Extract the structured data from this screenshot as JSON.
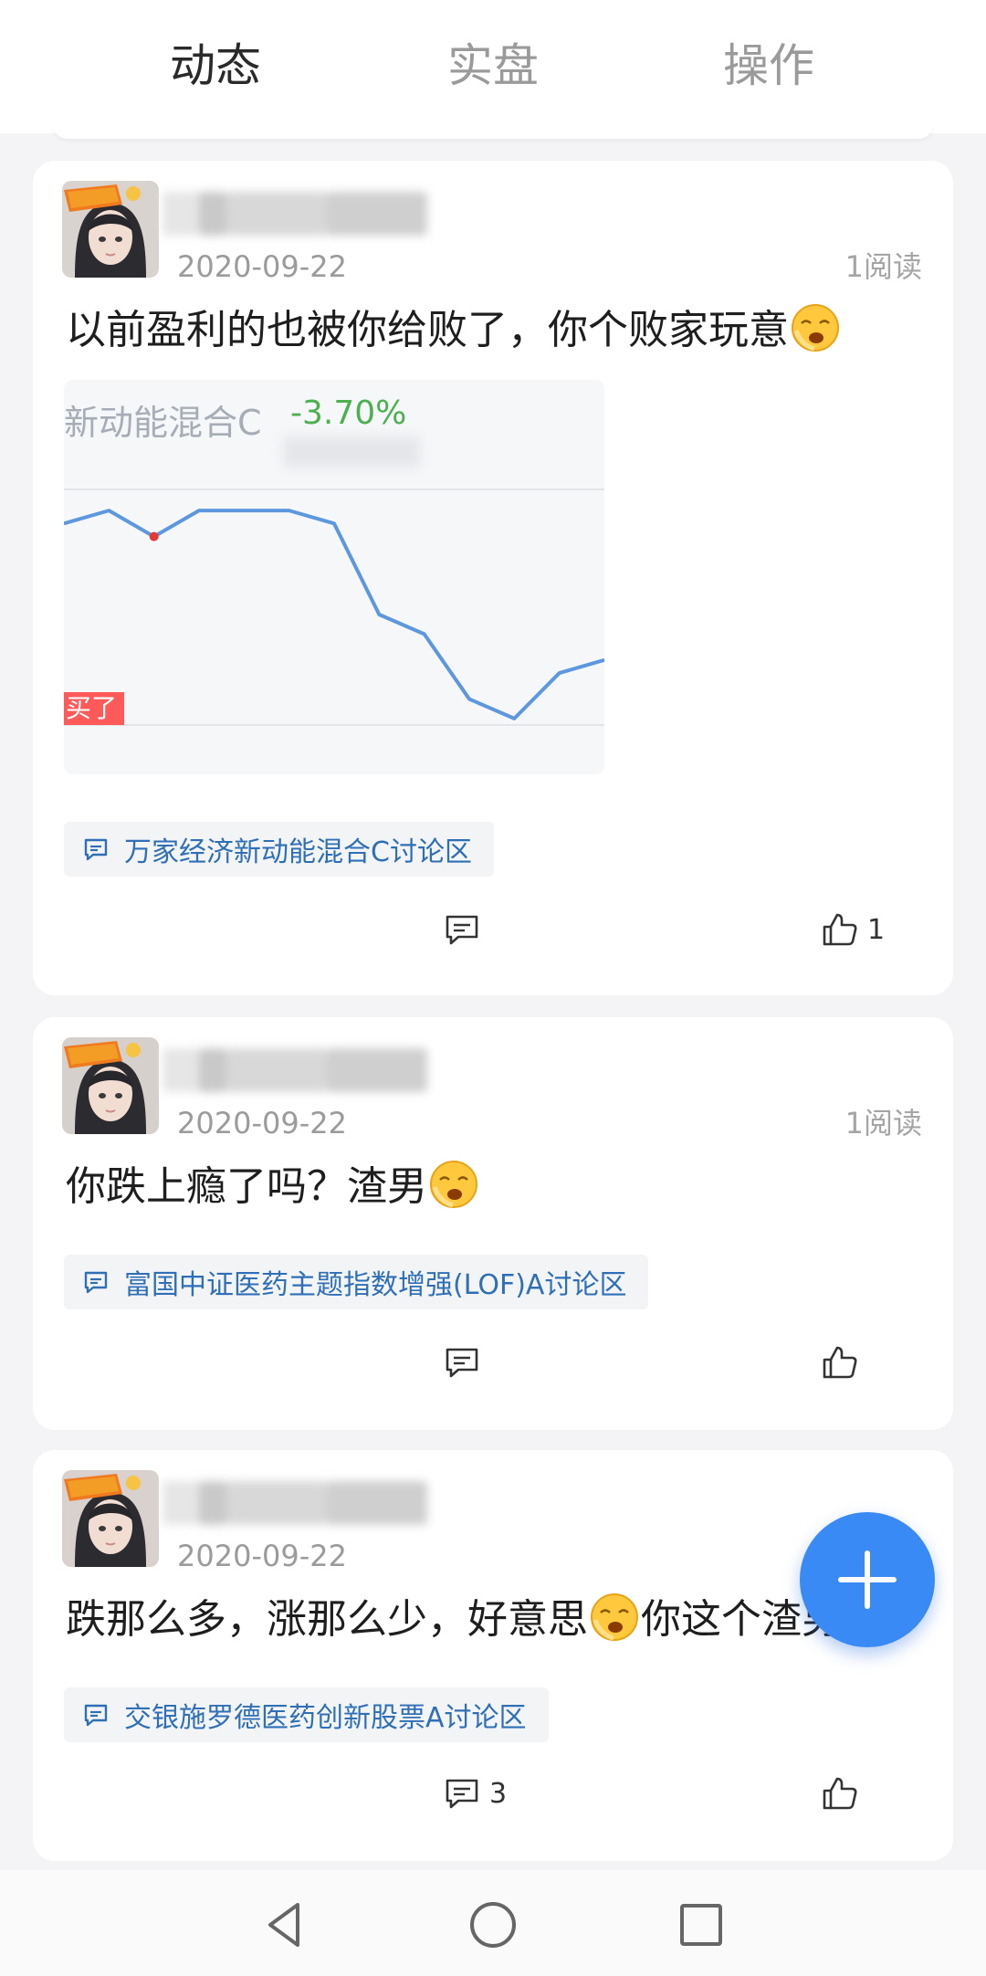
{
  "tabs": [
    {
      "label": "动态",
      "active": true
    },
    {
      "label": "实盘",
      "active": false
    },
    {
      "label": "操作",
      "active": false
    }
  ],
  "posts": [
    {
      "date": "2020-09-22",
      "reads": "1阅读",
      "text_before": "以前盈利的也被你给败了，你个败家玩意",
      "text_after": "",
      "emoji": "crying-emoji",
      "image": {
        "fund_name": "新动能混合C",
        "change": "-3.70%",
        "buy_tag": "买了",
        "chart_data": {
          "type": "line",
          "title": "",
          "xlabel": "",
          "ylabel": "",
          "x": [
            1,
            2,
            3,
            4,
            5,
            6,
            7,
            8,
            9,
            10,
            11,
            12,
            13
          ],
          "values": [
            3.0,
            3.4,
            2.6,
            3.4,
            3.4,
            3.4,
            3.0,
            0.2,
            -0.4,
            -2.4,
            -3.0,
            -1.6,
            -1.2
          ],
          "line_color": "#5d97de",
          "marker_point_index": 2,
          "marker_color": "#e53935"
        }
      },
      "topic": "万家经济新动能混合C讨论区",
      "comment_count": "",
      "like_count": "1"
    },
    {
      "date": "2020-09-22",
      "reads": "1阅读",
      "text_before": "你跌上瘾了吗？渣男",
      "text_after": "",
      "emoji": "crying-emoji",
      "topic": "富国中证医药主题指数增强(LOF)A讨论区",
      "comment_count": "",
      "like_count": ""
    },
    {
      "date": "2020-09-22",
      "reads": "",
      "text_before": "跌那么多，涨那么少，好意思",
      "text_after": "你这个渣男",
      "emoji": "crying-emoji",
      "topic": "交银施罗德医药创新股票A讨论区",
      "comment_count": "3",
      "like_count": ""
    }
  ],
  "fab": {
    "icon": "plus-icon"
  },
  "navbar": {
    "icons": [
      "back-triangle-icon",
      "home-circle-icon",
      "recents-square-icon"
    ]
  },
  "colors": {
    "accent": "#3a8af5",
    "topic_link": "#2f6fb6",
    "gain_green": "#4caf50",
    "buy_tag": "#ff5a5a"
  }
}
